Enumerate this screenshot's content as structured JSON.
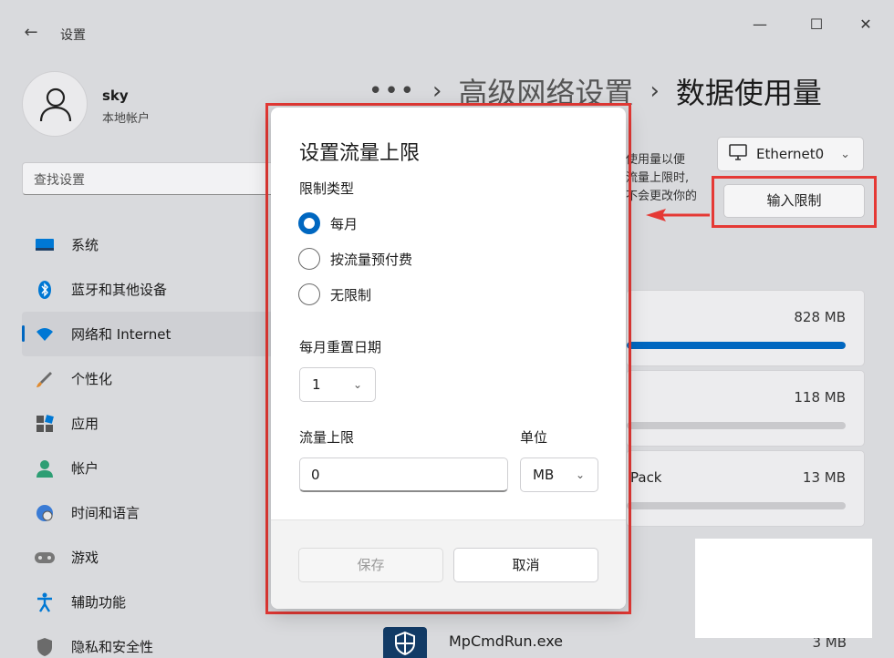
{
  "window": {
    "title": "设置",
    "back_icon": "arrow-left-icon",
    "controls": [
      "minimize-icon",
      "maximize-icon",
      "close-icon"
    ]
  },
  "user": {
    "name": "sky",
    "account_type": "本地帐户"
  },
  "search": {
    "placeholder": "查找设置"
  },
  "sidebar": {
    "items": [
      {
        "label": "系统",
        "icon": "monitor-icon",
        "active": false
      },
      {
        "label": "蓝牙和其他设备",
        "icon": "bluetooth-icon",
        "active": false
      },
      {
        "label": "网络和 Internet",
        "icon": "wifi-icon",
        "active": true
      },
      {
        "label": "个性化",
        "icon": "brush-icon",
        "active": false
      },
      {
        "label": "应用",
        "icon": "apps-icon",
        "active": false
      },
      {
        "label": "帐户",
        "icon": "person-icon",
        "active": false
      },
      {
        "label": "时间和语言",
        "icon": "globe-clock-icon",
        "active": false
      },
      {
        "label": "游戏",
        "icon": "gamepad-icon",
        "active": false
      },
      {
        "label": "辅助功能",
        "icon": "accessibility-icon",
        "active": false
      },
      {
        "label": "隐私和安全性",
        "icon": "shield-icon",
        "active": false
      }
    ]
  },
  "breadcrumb": {
    "ellipsis": "•••",
    "parent": "高级网络设置",
    "current": "数据使用量"
  },
  "main": {
    "hint_lines": [
      "使用量以便",
      "流量上限时,",
      "不会更改你的"
    ],
    "adapter": "Ethernet0",
    "enter_limit_label": "输入限制",
    "apps": [
      {
        "label": "",
        "size": "828 MB",
        "fill": 1.0
      },
      {
        "label": "",
        "size": "118 MB",
        "fill": 0.0
      },
      {
        "label": "Pack",
        "size": "13 MB",
        "fill": 0.0
      }
    ],
    "bottom_app": {
      "name": "MpCmdRun.exe",
      "size": "3 MB"
    }
  },
  "dialog": {
    "title": "设置流量上限",
    "limit_type_label": "限制类型",
    "options": [
      {
        "label": "每月",
        "selected": true
      },
      {
        "label": "按流量预付费",
        "selected": false
      },
      {
        "label": "无限制",
        "selected": false
      }
    ],
    "reset_day_label": "每月重置日期",
    "reset_day_value": "1",
    "limit_label": "流量上限",
    "limit_value": "0",
    "unit_label": "单位",
    "unit_value": "MB",
    "save_label": "保存",
    "cancel_label": "取消"
  },
  "colors": {
    "accent": "#0067c0",
    "highlight": "#e53935"
  }
}
